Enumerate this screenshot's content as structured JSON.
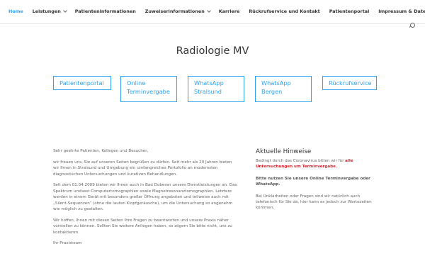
{
  "nav": {
    "items": [
      {
        "label": "Home",
        "dropdown": false,
        "active": true
      },
      {
        "label": "Leistungen",
        "dropdown": true,
        "active": false
      },
      {
        "label": "Patienteninformationen",
        "dropdown": false,
        "active": false
      },
      {
        "label": "Zuweiserinformationen",
        "dropdown": true,
        "active": false
      },
      {
        "label": "Karriere",
        "dropdown": false,
        "active": false
      },
      {
        "label": "Rückrufservice und Kontakt",
        "dropdown": false,
        "active": false
      },
      {
        "label": "Patientenportal",
        "dropdown": false,
        "active": false
      },
      {
        "label": "Impressum & Datenschutz",
        "dropdown": false,
        "active": false
      }
    ],
    "search_icon": "search-icon"
  },
  "site_title": "Radiologie MV",
  "buttons": {
    "patientenportal": "Patientenportal",
    "online_line1": "Online",
    "online_line2": "Terminvergabe",
    "whatsapp_stralsund_line1": "WhatsApp",
    "whatsapp_stralsund_line2": "Stralsund",
    "whatsapp_bergen_line1": "WhatsApp",
    "whatsapp_bergen_line2": "Bergen",
    "rueckrufservice": "Rückrufservice"
  },
  "main": {
    "greeting": "Sehr geehrte Patienten, Kollegen und Besucher,",
    "p1": "wir freuen uns, Sie auf unseren Seiten begrüßen zu dürfen. Seit mehr als 20 Jahren bieten wir Ihnen in Stralsund und Umgebung ein umfangreiches Portofolio an modernsten diagnostischen Untersuchungen und kurativen Behandlungen.",
    "p2": "Seit dem 01.04.2009 bieten wir Ihnen auch in Bad Doberan unsere Dienstleistungen an. Das Spektrum umfasst Computertomographien sowie Magnetresonanztomographien. Letztere werden in einem Gerät mit besonders großer Öffnung angeboten und teilweise auch mit „Silent-Sequenzen“ (ohne die lauten Klopfgeräusche), um die Untersuchung so angenehm wie möglich zu gestalten.",
    "p3": "Wir hoffen, Ihnen mit diesen Seiten Ihre Fragen zu beantworten und unsere Praxis näher vorstellen zu können. Sollten Sie weitere Anliegen haben, so zögern Sie bitte nicht, uns zu kontaktieren.",
    "signature": "Ihr Praxisteam"
  },
  "aside": {
    "title": "Aktuelle Hinweise",
    "notice_prefix": "Bedingt durch das Coronavirus bitten wir für ",
    "notice_highlight": "alle Untersuchungen um Terminvergabe.",
    "notice_strong": "Bitte nutzen Sie unsere Online Terminvergabe oder WhatsApp.",
    "notice_end": "Bei Unklarheiten oder Fragen sind wir natürlich auch telefonisch für Sie da, hier kann es jedoch zur Wartezeiten kommen."
  },
  "colors": {
    "accent": "#2ea3f2",
    "highlight_red": "#d4232b",
    "text": "#666666",
    "heading": "#333333"
  }
}
